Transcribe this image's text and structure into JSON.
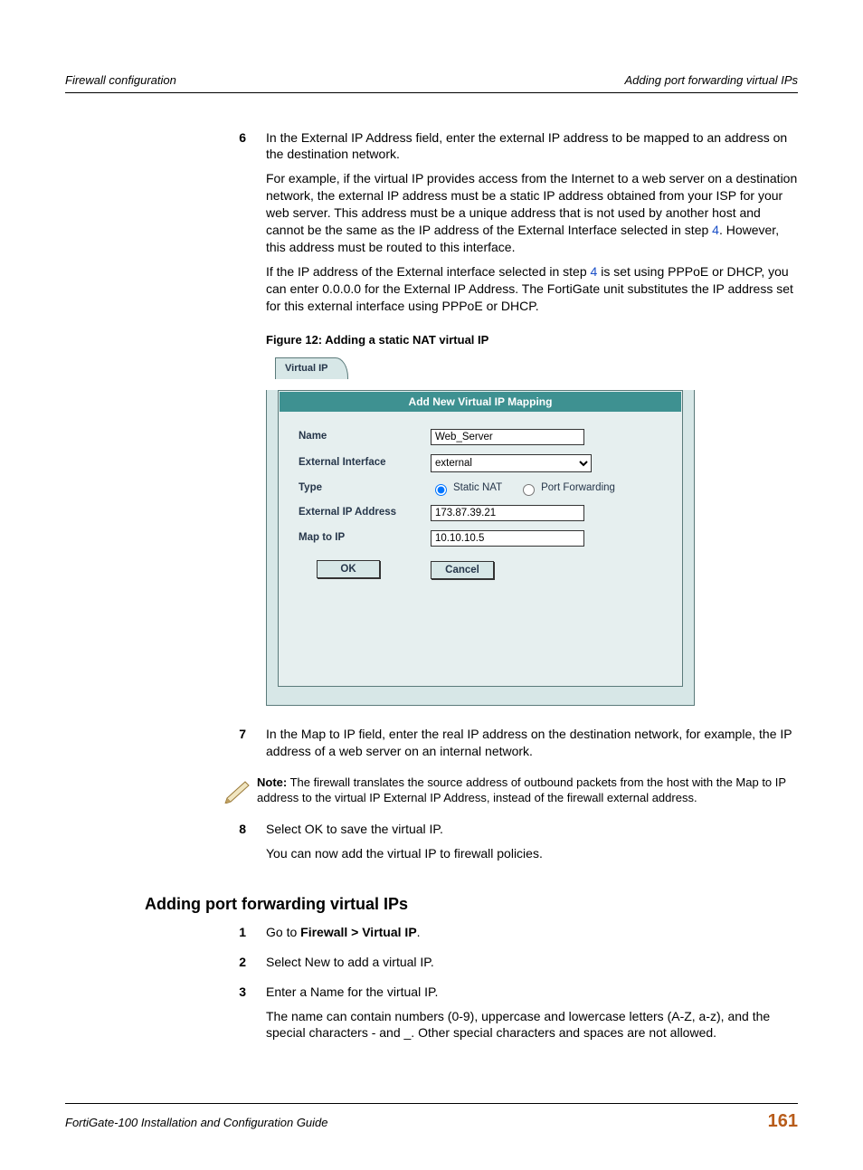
{
  "header": {
    "left": "Firewall configuration",
    "right": "Adding port forwarding virtual IPs"
  },
  "steps_a": [
    {
      "num": "6",
      "paras": [
        "In the External IP Address field, enter the external IP address to be mapped to an address on the destination network.",
        "For example, if the virtual IP provides access from the Internet to a web server on a destination network, the external IP address must be a static IP address obtained from your ISP for your web server. This address must be a unique address that is not used by another host and cannot be the same as the IP address of the External Interface selected in step {link4a}. However, this address must be routed to this interface.",
        "If the IP address of the External interface selected in step {link4b} is set using PPPoE or DHCP, you can enter 0.0.0.0 for the External IP Address. The FortiGate unit substitutes the IP address set for this external interface using PPPoE or DHCP."
      ]
    }
  ],
  "link4": "4",
  "figure_caption": "Figure 12: Adding a static NAT virtual IP",
  "figure": {
    "tab": "Virtual IP",
    "panel_title": "Add New Virtual IP Mapping",
    "labels": {
      "name": "Name",
      "ext_if": "External Interface",
      "type": "Type",
      "ext_ip": "External IP Address",
      "map_ip": "Map to IP"
    },
    "values": {
      "name": "Web_Server",
      "ext_if": "external",
      "type_static": "Static NAT",
      "type_pf": "Port Forwarding",
      "ext_ip": "173.87.39.21",
      "map_ip": "10.10.10.5"
    },
    "buttons": {
      "ok": "OK",
      "cancel": "Cancel"
    }
  },
  "step7": {
    "num": "7",
    "text": "In the Map to IP field, enter the real IP address on the destination network, for example, the IP address of a web server on an internal network."
  },
  "note": {
    "label": "Note:",
    "text": " The firewall translates the source address of outbound packets from the host with the Map to IP address to the virtual IP External IP Address, instead of the firewall external address."
  },
  "step8": {
    "num": "8",
    "p1": "Select OK to save the virtual IP.",
    "p2": "You can now add the virtual IP to firewall policies."
  },
  "section_heading": "Adding port forwarding virtual IPs",
  "steps_b": [
    {
      "num": "1",
      "prefix": "Go to ",
      "bold": "Firewall > Virtual IP",
      "suffix": "."
    },
    {
      "num": "2",
      "text": "Select New to add a virtual IP."
    },
    {
      "num": "3",
      "p1": "Enter a Name for the virtual IP.",
      "p2": "The name can contain numbers (0-9), uppercase and lowercase letters (A-Z, a-z), and the special characters - and _. Other special characters and spaces are not allowed."
    }
  ],
  "footer": {
    "left": "FortiGate-100 Installation and Configuration Guide",
    "page": "161"
  }
}
